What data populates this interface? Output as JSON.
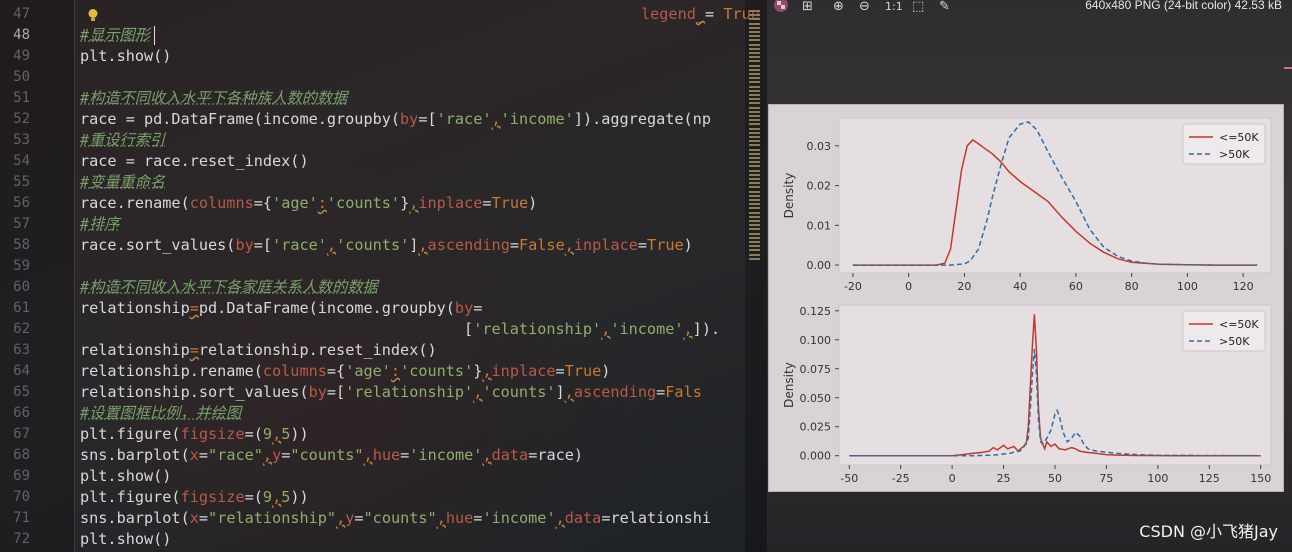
{
  "editor": {
    "line_numbers": [
      "47",
      "48",
      "49",
      "50",
      "51",
      "52",
      "53",
      "54",
      "55",
      "56",
      "57",
      "58",
      "59",
      "60",
      "61",
      "62",
      "63",
      "64",
      "65",
      "66",
      "67",
      "68",
      "69",
      "70",
      "71",
      "72"
    ],
    "current_line": "48",
    "lines": [
      [
        {
          "t": "legend",
          "c": "pm"
        },
        {
          "t": "_",
          "c": "sep"
        },
        {
          "t": "= ",
          "c": ""
        },
        {
          "t": "True",
          "c": "kw"
        }
      ],
      [
        {
          "t": "#显示图形",
          "c": "cm"
        }
      ],
      [
        {
          "t": "plt.show()",
          "c": ""
        }
      ],
      [],
      [
        {
          "t": "#构造不同收入水平下各种族人数的数据",
          "c": "cm"
        }
      ],
      [
        {
          "t": "race = pd.DataFrame(income.groupby(",
          "c": ""
        },
        {
          "t": "by",
          "c": "pm"
        },
        {
          "t": "=[",
          "c": ""
        },
        {
          "t": "'race'",
          "c": "st"
        },
        {
          "t": ",",
          "c": "sep"
        },
        {
          "t": "'income'",
          "c": "st"
        },
        {
          "t": "]).aggregate(np",
          "c": ""
        }
      ],
      [
        {
          "t": "#重设行索引",
          "c": "cm"
        }
      ],
      [
        {
          "t": "race = race.reset_index()",
          "c": ""
        }
      ],
      [
        {
          "t": "#变量重命名",
          "c": "cm"
        }
      ],
      [
        {
          "t": "race.rename(",
          "c": ""
        },
        {
          "t": "columns",
          "c": "pm"
        },
        {
          "t": "={",
          "c": ""
        },
        {
          "t": "'age'",
          "c": "st"
        },
        {
          "t": ":",
          "c": "sep"
        },
        {
          "t": "'counts'",
          "c": "st"
        },
        {
          "t": "}",
          "c": ""
        },
        {
          "t": ",",
          "c": "sep"
        },
        {
          "t": "inplace",
          "c": "pm"
        },
        {
          "t": "=",
          "c": ""
        },
        {
          "t": "True",
          "c": "kw"
        },
        {
          "t": ")",
          "c": ""
        }
      ],
      [
        {
          "t": "#排序",
          "c": "cm"
        }
      ],
      [
        {
          "t": "race.sort_values(",
          "c": ""
        },
        {
          "t": "by",
          "c": "pm"
        },
        {
          "t": "=[",
          "c": ""
        },
        {
          "t": "'race'",
          "c": "st"
        },
        {
          "t": ",",
          "c": "sep"
        },
        {
          "t": "'counts'",
          "c": "st"
        },
        {
          "t": "]",
          "c": ""
        },
        {
          "t": ",",
          "c": "sep"
        },
        {
          "t": "ascending",
          "c": "pm"
        },
        {
          "t": "=",
          "c": ""
        },
        {
          "t": "False",
          "c": "kw"
        },
        {
          "t": ",",
          "c": "sep"
        },
        {
          "t": "inplace",
          "c": "pm"
        },
        {
          "t": "=",
          "c": ""
        },
        {
          "t": "True",
          "c": "kw"
        },
        {
          "t": ")",
          "c": ""
        }
      ],
      [],
      [
        {
          "t": "#构造不同收入水平下各家庭关系人数的数据",
          "c": "cm"
        }
      ],
      [
        {
          "t": "relationship",
          "c": ""
        },
        {
          "t": "=",
          "c": "sep"
        },
        {
          "t": "pd.DataFrame(income.groupby(",
          "c": ""
        },
        {
          "t": "by",
          "c": "pm"
        },
        {
          "t": "=",
          "c": ""
        }
      ],
      [
        {
          "t": "                                          [",
          "c": ""
        },
        {
          "t": "'relationship'",
          "c": "st"
        },
        {
          "t": ",",
          "c": "sep"
        },
        {
          "t": "'income'",
          "c": "st"
        },
        {
          "t": ",",
          "c": "sep"
        },
        {
          "t": "]).",
          "c": ""
        }
      ],
      [
        {
          "t": "relationship",
          "c": ""
        },
        {
          "t": "=",
          "c": "sep"
        },
        {
          "t": "relationship.reset_index()",
          "c": ""
        }
      ],
      [
        {
          "t": "relationship.rename(",
          "c": ""
        },
        {
          "t": "columns",
          "c": "pm"
        },
        {
          "t": "={",
          "c": ""
        },
        {
          "t": "'age'",
          "c": "st"
        },
        {
          "t": ":",
          "c": "sep"
        },
        {
          "t": "'counts'",
          "c": "st"
        },
        {
          "t": "}",
          "c": ""
        },
        {
          "t": ",",
          "c": "sep"
        },
        {
          "t": "inplace",
          "c": "pm"
        },
        {
          "t": "=",
          "c": ""
        },
        {
          "t": "True",
          "c": "kw"
        },
        {
          "t": ")",
          "c": ""
        }
      ],
      [
        {
          "t": "relationship.sort_values(",
          "c": ""
        },
        {
          "t": "by",
          "c": "pm"
        },
        {
          "t": "=[",
          "c": ""
        },
        {
          "t": "'relationship'",
          "c": "st"
        },
        {
          "t": ",",
          "c": "sep"
        },
        {
          "t": "'counts'",
          "c": "st"
        },
        {
          "t": "]",
          "c": ""
        },
        {
          "t": ",",
          "c": "sep"
        },
        {
          "t": "ascending",
          "c": "pm"
        },
        {
          "t": "=",
          "c": ""
        },
        {
          "t": "Fals",
          "c": "kw"
        }
      ],
      [
        {
          "t": "#设置图框比例，并绘图",
          "c": "cm"
        }
      ],
      [
        {
          "t": "plt.figure(",
          "c": ""
        },
        {
          "t": "figsize",
          "c": "pm"
        },
        {
          "t": "=(",
          "c": ""
        },
        {
          "t": "9",
          "c": "st"
        },
        {
          "t": ",",
          "c": "sep"
        },
        {
          "t": "5",
          "c": "st"
        },
        {
          "t": "))",
          "c": ""
        }
      ],
      [
        {
          "t": "sns.barplot(",
          "c": ""
        },
        {
          "t": "x",
          "c": "pm"
        },
        {
          "t": "=",
          "c": ""
        },
        {
          "t": "\"race\"",
          "c": "st"
        },
        {
          "t": ",",
          "c": "sep"
        },
        {
          "t": "y",
          "c": "pm"
        },
        {
          "t": "=",
          "c": ""
        },
        {
          "t": "\"counts\"",
          "c": "st"
        },
        {
          "t": ",",
          "c": "sep"
        },
        {
          "t": "hue",
          "c": "pm"
        },
        {
          "t": "=",
          "c": ""
        },
        {
          "t": "'income'",
          "c": "st"
        },
        {
          "t": ",",
          "c": "sep"
        },
        {
          "t": "data",
          "c": "pm"
        },
        {
          "t": "=race)",
          "c": ""
        }
      ],
      [
        {
          "t": "plt.show()",
          "c": ""
        }
      ],
      [
        {
          "t": "plt.figure(",
          "c": ""
        },
        {
          "t": "figsize",
          "c": "pm"
        },
        {
          "t": "=(",
          "c": ""
        },
        {
          "t": "9",
          "c": "st"
        },
        {
          "t": ",",
          "c": "sep"
        },
        {
          "t": "5",
          "c": "st"
        },
        {
          "t": "))",
          "c": ""
        }
      ],
      [
        {
          "t": "sns.barplot(",
          "c": ""
        },
        {
          "t": "x",
          "c": "pm"
        },
        {
          "t": "=",
          "c": ""
        },
        {
          "t": "\"relationship\"",
          "c": "st"
        },
        {
          "t": ",",
          "c": "sep"
        },
        {
          "t": "y",
          "c": "pm"
        },
        {
          "t": "=",
          "c": ""
        },
        {
          "t": "\"counts\"",
          "c": "st"
        },
        {
          "t": ",",
          "c": "sep"
        },
        {
          "t": "hue",
          "c": "pm"
        },
        {
          "t": "=",
          "c": ""
        },
        {
          "t": "'income'",
          "c": "st"
        },
        {
          "t": ",",
          "c": "sep"
        },
        {
          "t": "data",
          "c": "pm"
        },
        {
          "t": "=relationshi",
          "c": ""
        }
      ],
      [
        {
          "t": "plt.show()",
          "c": ""
        }
      ]
    ]
  },
  "viewer": {
    "image_info": "640x480 PNG (24-bit color) 42.53 kB",
    "toolbar_glyphs": [
      "⊞",
      "⊕",
      "⊖",
      "1:1",
      "⬚",
      "✎"
    ],
    "watermark": "CSDN @小飞猪Jay"
  },
  "chart_data": [
    {
      "type": "line",
      "xlabel": "",
      "ylabel": "Density",
      "xlim": [
        -25,
        130
      ],
      "ylim": [
        -0.002,
        0.037
      ],
      "xticks": [
        -20,
        0,
        20,
        40,
        60,
        80,
        100,
        120
      ],
      "yticks": [
        0.0,
        0.01,
        0.02,
        0.03
      ],
      "ytick_labels": [
        "0.00",
        "0.01",
        "0.02",
        "0.03"
      ],
      "legend": "top-right",
      "series": [
        {
          "name": "<=50K",
          "color": "#c0392b",
          "dash": false,
          "x": [
            -20,
            0,
            10,
            13,
            15,
            17,
            19,
            21,
            23,
            25,
            27,
            30,
            33,
            36,
            40,
            45,
            50,
            55,
            60,
            65,
            70,
            75,
            80,
            90,
            100,
            110,
            125
          ],
          "y": [
            0,
            0,
            0,
            0.0005,
            0.004,
            0.014,
            0.024,
            0.03,
            0.0315,
            0.0305,
            0.0295,
            0.028,
            0.026,
            0.0235,
            0.021,
            0.0185,
            0.016,
            0.012,
            0.0085,
            0.0055,
            0.0032,
            0.0016,
            0.0007,
            0.0002,
            0.0001,
            0,
            0
          ]
        },
        {
          "name": ">50K",
          "color": "#2f6fa6",
          "dash": true,
          "x": [
            -20,
            0,
            15,
            20,
            22,
            25,
            28,
            30,
            33,
            36,
            40,
            43,
            46,
            50,
            55,
            60,
            65,
            70,
            75,
            80,
            85,
            90,
            100,
            110,
            125
          ],
          "y": [
            0,
            0,
            0,
            0.0003,
            0.001,
            0.004,
            0.011,
            0.017,
            0.025,
            0.032,
            0.0355,
            0.036,
            0.034,
            0.0285,
            0.022,
            0.016,
            0.009,
            0.0045,
            0.0022,
            0.001,
            0.0005,
            0.0002,
            0.0001,
            0,
            0
          ]
        }
      ]
    },
    {
      "type": "line",
      "xlabel": "",
      "ylabel": "Density",
      "xlim": [
        -55,
        155
      ],
      "ylim": [
        -0.008,
        0.13
      ],
      "xticks": [
        -50,
        -25,
        0,
        25,
        50,
        75,
        100,
        125,
        150
      ],
      "yticks": [
        0,
        0.025,
        0.05,
        0.075,
        0.1,
        0.125
      ],
      "ytick_labels": [
        "0.000",
        "0.025",
        "0.050",
        "0.075",
        "0.100",
        "0.125"
      ],
      "legend": "top-right",
      "series": [
        {
          "name": "<=50K",
          "color": "#c0392b",
          "dash": false,
          "x": [
            -50,
            0,
            5,
            10,
            15,
            18,
            20,
            22,
            25,
            27,
            30,
            32,
            34,
            36,
            37,
            38,
            39,
            40,
            41,
            42,
            43,
            44,
            45,
            46,
            48,
            50,
            52,
            55,
            58,
            60,
            62,
            65,
            70,
            75,
            80,
            90,
            100,
            110,
            150
          ],
          "y": [
            0,
            0,
            0.001,
            0.002,
            0.003,
            0.004,
            0.007,
            0.005,
            0.009,
            0.006,
            0.008,
            0.004,
            0.007,
            0.01,
            0.025,
            0.06,
            0.095,
            0.122,
            0.09,
            0.04,
            0.015,
            0.01,
            0.006,
            0.012,
            0.008,
            0.01,
            0.006,
            0.005,
            0.007,
            0.006,
            0.004,
            0.003,
            0.002,
            0.001,
            0.0005,
            0.0002,
            0.0001,
            0,
            0
          ]
        },
        {
          "name": ">50K",
          "color": "#2f6fa6",
          "dash": true,
          "x": [
            -50,
            0,
            10,
            20,
            25,
            28,
            30,
            33,
            35,
            37,
            38,
            39,
            40,
            41,
            42,
            43,
            44,
            46,
            48,
            50,
            51,
            52,
            54,
            56,
            58,
            60,
            62,
            64,
            66,
            70,
            75,
            80,
            90,
            100,
            150
          ],
          "y": [
            0,
            0,
            0,
            0.0005,
            0.0015,
            0.002,
            0.003,
            0.004,
            0.008,
            0.015,
            0.04,
            0.07,
            0.092,
            0.07,
            0.03,
            0.012,
            0.01,
            0.015,
            0.022,
            0.036,
            0.039,
            0.035,
            0.02,
            0.012,
            0.015,
            0.02,
            0.017,
            0.01,
            0.006,
            0.004,
            0.003,
            0.002,
            0.001,
            0.0004,
            0
          ]
        }
      ]
    }
  ]
}
